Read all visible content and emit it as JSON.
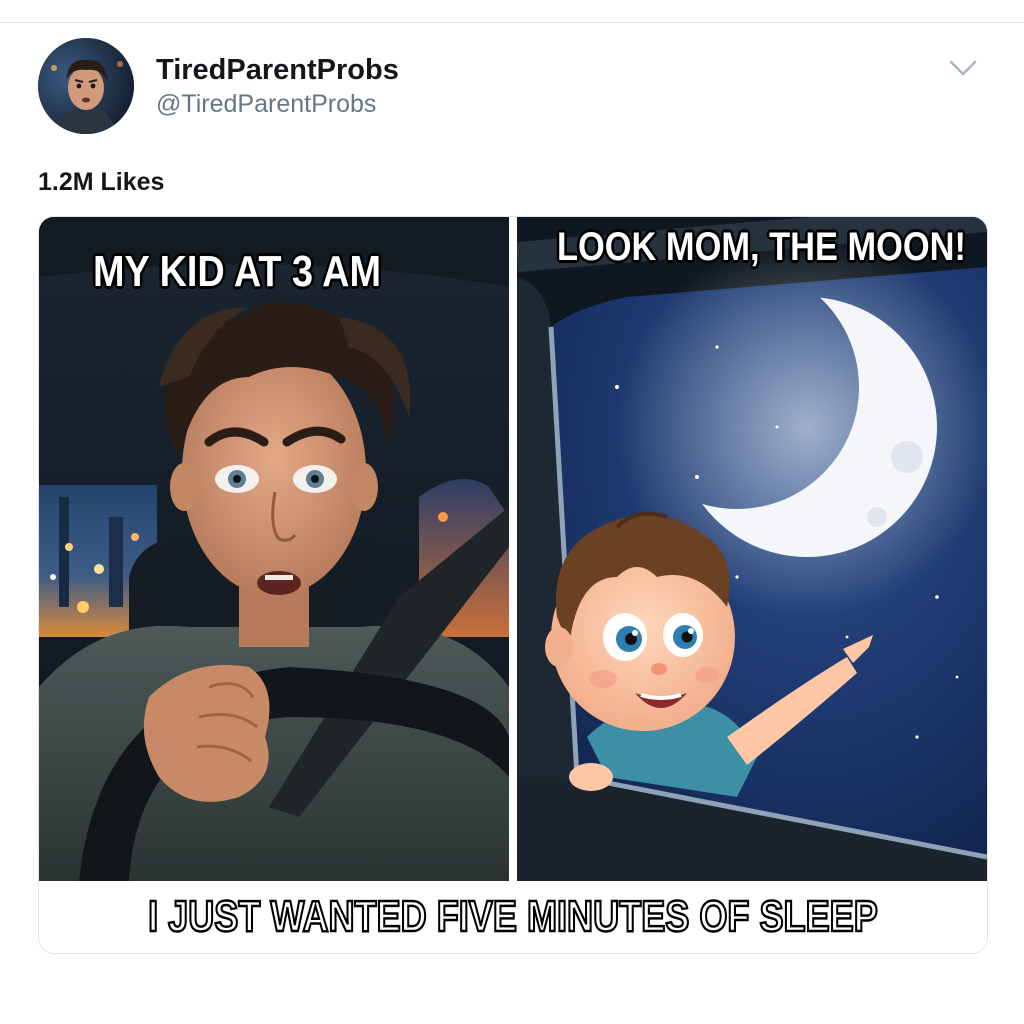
{
  "post": {
    "display_name": "TiredParentProbs",
    "handle": "@TiredParentProbs",
    "likes": "1.2M Likes"
  },
  "meme": {
    "left_caption": "MY KID AT 3 AM",
    "right_caption": "LOOK MOM, THE MOON!",
    "bottom_caption": "I JUST WANTED FIVE MINUTES OF SLEEP"
  },
  "icons": {
    "menu": "chevron-down-icon"
  }
}
